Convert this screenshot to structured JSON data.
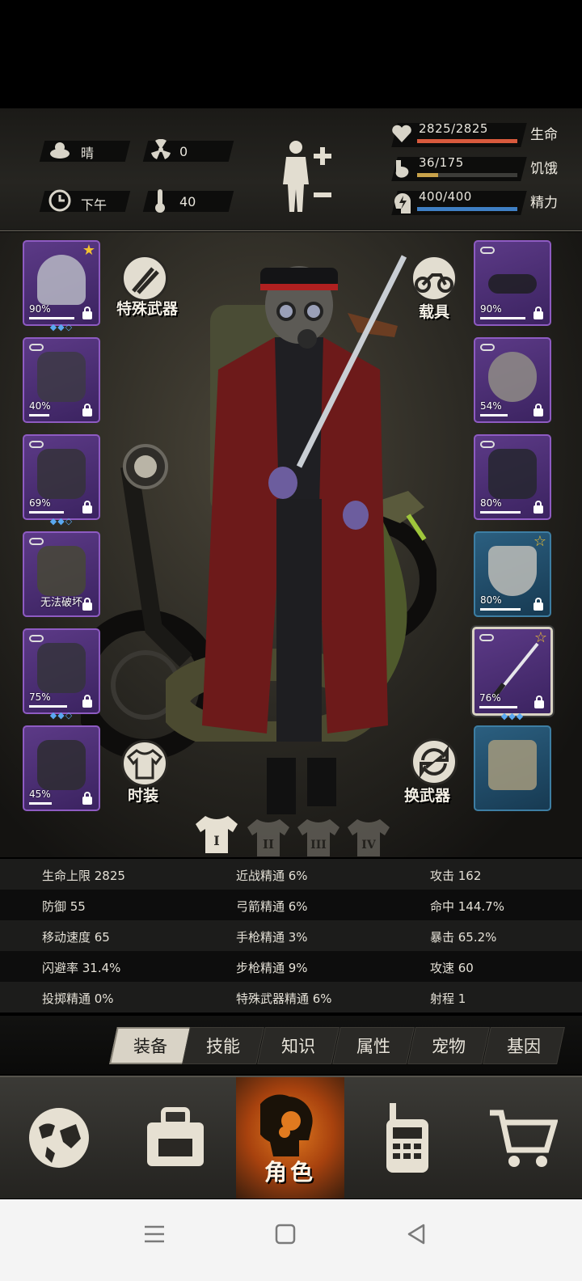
{
  "environment": {
    "weather": "晴",
    "radiation": "0",
    "time_of_day": "下午",
    "temperature": "40"
  },
  "vitals": [
    {
      "label": "生命",
      "value": "2825/2825",
      "fill": 1.0,
      "color": "#d85a3d"
    },
    {
      "label": "饥饿",
      "value": "36/175",
      "fill": 0.21,
      "color": "#c8a24a"
    },
    {
      "label": "精力",
      "value": "400/400",
      "fill": 1.0,
      "color": "#3f7fc4"
    }
  ],
  "left_slots": [
    {
      "name": "helmet",
      "pct": "90%",
      "gems": "◆◆◇",
      "star": true
    },
    {
      "name": "shirt",
      "pct": "40%",
      "gems": "",
      "star": false
    },
    {
      "name": "jacket",
      "pct": "69%",
      "gems": "◆◆◇",
      "star": false
    },
    {
      "name": "backpack",
      "pct": "无法破坏",
      "gems": "",
      "star": false
    },
    {
      "name": "pants",
      "pct": "75%",
      "gems": "◆◆◇",
      "star": false
    },
    {
      "name": "boots",
      "pct": "45%",
      "gems": "",
      "star": false
    }
  ],
  "right_slots": [
    {
      "name": "goggles",
      "pct": "90%",
      "gems": "",
      "star": false
    },
    {
      "name": "gas-mask",
      "pct": "54%",
      "gems": "",
      "star": false
    },
    {
      "name": "police-vest",
      "pct": "80%",
      "gems": "",
      "star": false
    },
    {
      "name": "shield",
      "pct": "80%",
      "gems": "",
      "star": true
    },
    {
      "name": "katana",
      "pct": "76%",
      "gems": "◆◆◆",
      "star": true
    },
    {
      "name": "dynamite",
      "pct": "",
      "gems": "",
      "star": false
    }
  ],
  "buttons": {
    "special_weapon": "特殊武器",
    "vehicle": "载具",
    "fashion": "时装",
    "switch_weapon": "换武器"
  },
  "outfit_tabs": [
    "I",
    "II",
    "III",
    "IV"
  ],
  "stats": [
    [
      "生命上限 2825",
      "近战精通 6%",
      "攻击 162"
    ],
    [
      "防御 55",
      "弓箭精通 6%",
      "命中 144.7%"
    ],
    [
      "移动速度 65",
      "手枪精通 3%",
      "暴击 65.2%"
    ],
    [
      "闪避率 31.4%",
      "步枪精通 9%",
      "攻速 60"
    ],
    [
      "投掷精通 0%",
      "特殊武器精通 6%",
      "射程 1"
    ]
  ],
  "tabs": [
    "装备",
    "技能",
    "知识",
    "属性",
    "宠物",
    "基因"
  ],
  "nav": [
    "world",
    "bag",
    "角色",
    "radio",
    "shop"
  ],
  "nav_active_label": "角色"
}
